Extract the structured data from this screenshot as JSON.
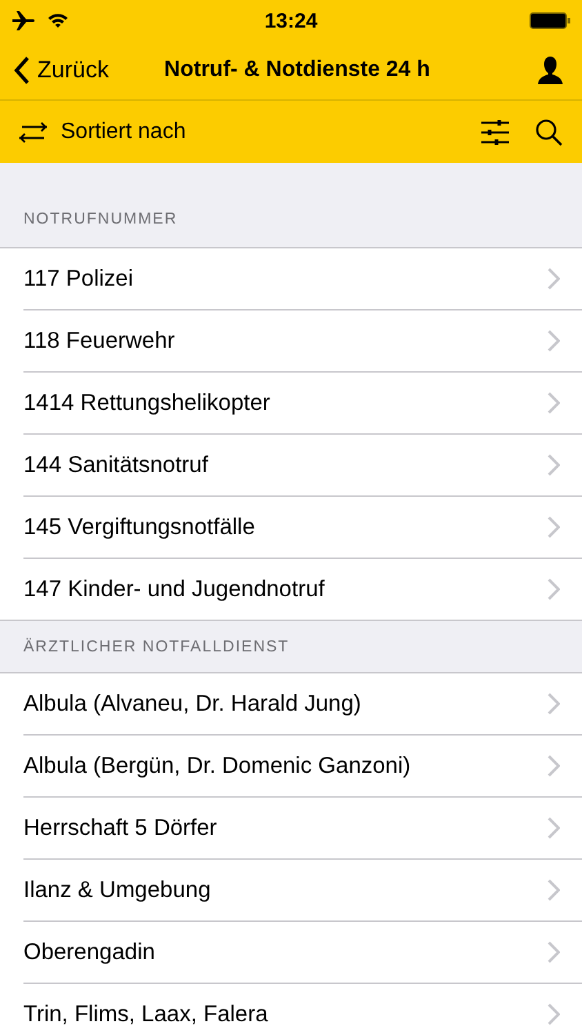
{
  "status_bar": {
    "time": "13:24"
  },
  "nav": {
    "back": "Zurück",
    "title": "Notruf- & Notdienste 24 h"
  },
  "toolbar": {
    "sort_label": "Sortiert nach"
  },
  "sections": [
    {
      "header": "NOTRUFNUMMER",
      "rows": [
        {
          "label": "117 Polizei"
        },
        {
          "label": "118 Feuerwehr"
        },
        {
          "label": "1414 Rettungshelikopter"
        },
        {
          "label": "144 Sanitätsnotruf"
        },
        {
          "label": "145 Vergiftungsnotfälle"
        },
        {
          "label": "147 Kinder- und Jugendnotruf"
        }
      ]
    },
    {
      "header": "ÄRZTLICHER NOTFALLDIENST",
      "rows": [
        {
          "label": "Albula (Alvaneu, Dr. Harald Jung)"
        },
        {
          "label": "Albula (Bergün, Dr. Domenic Ganzoni)"
        },
        {
          "label": "Herrschaft 5 Dörfer"
        },
        {
          "label": "Ilanz & Umgebung"
        },
        {
          "label": "Oberengadin"
        },
        {
          "label": "Trin, Flims, Laax, Falera"
        }
      ]
    }
  ]
}
